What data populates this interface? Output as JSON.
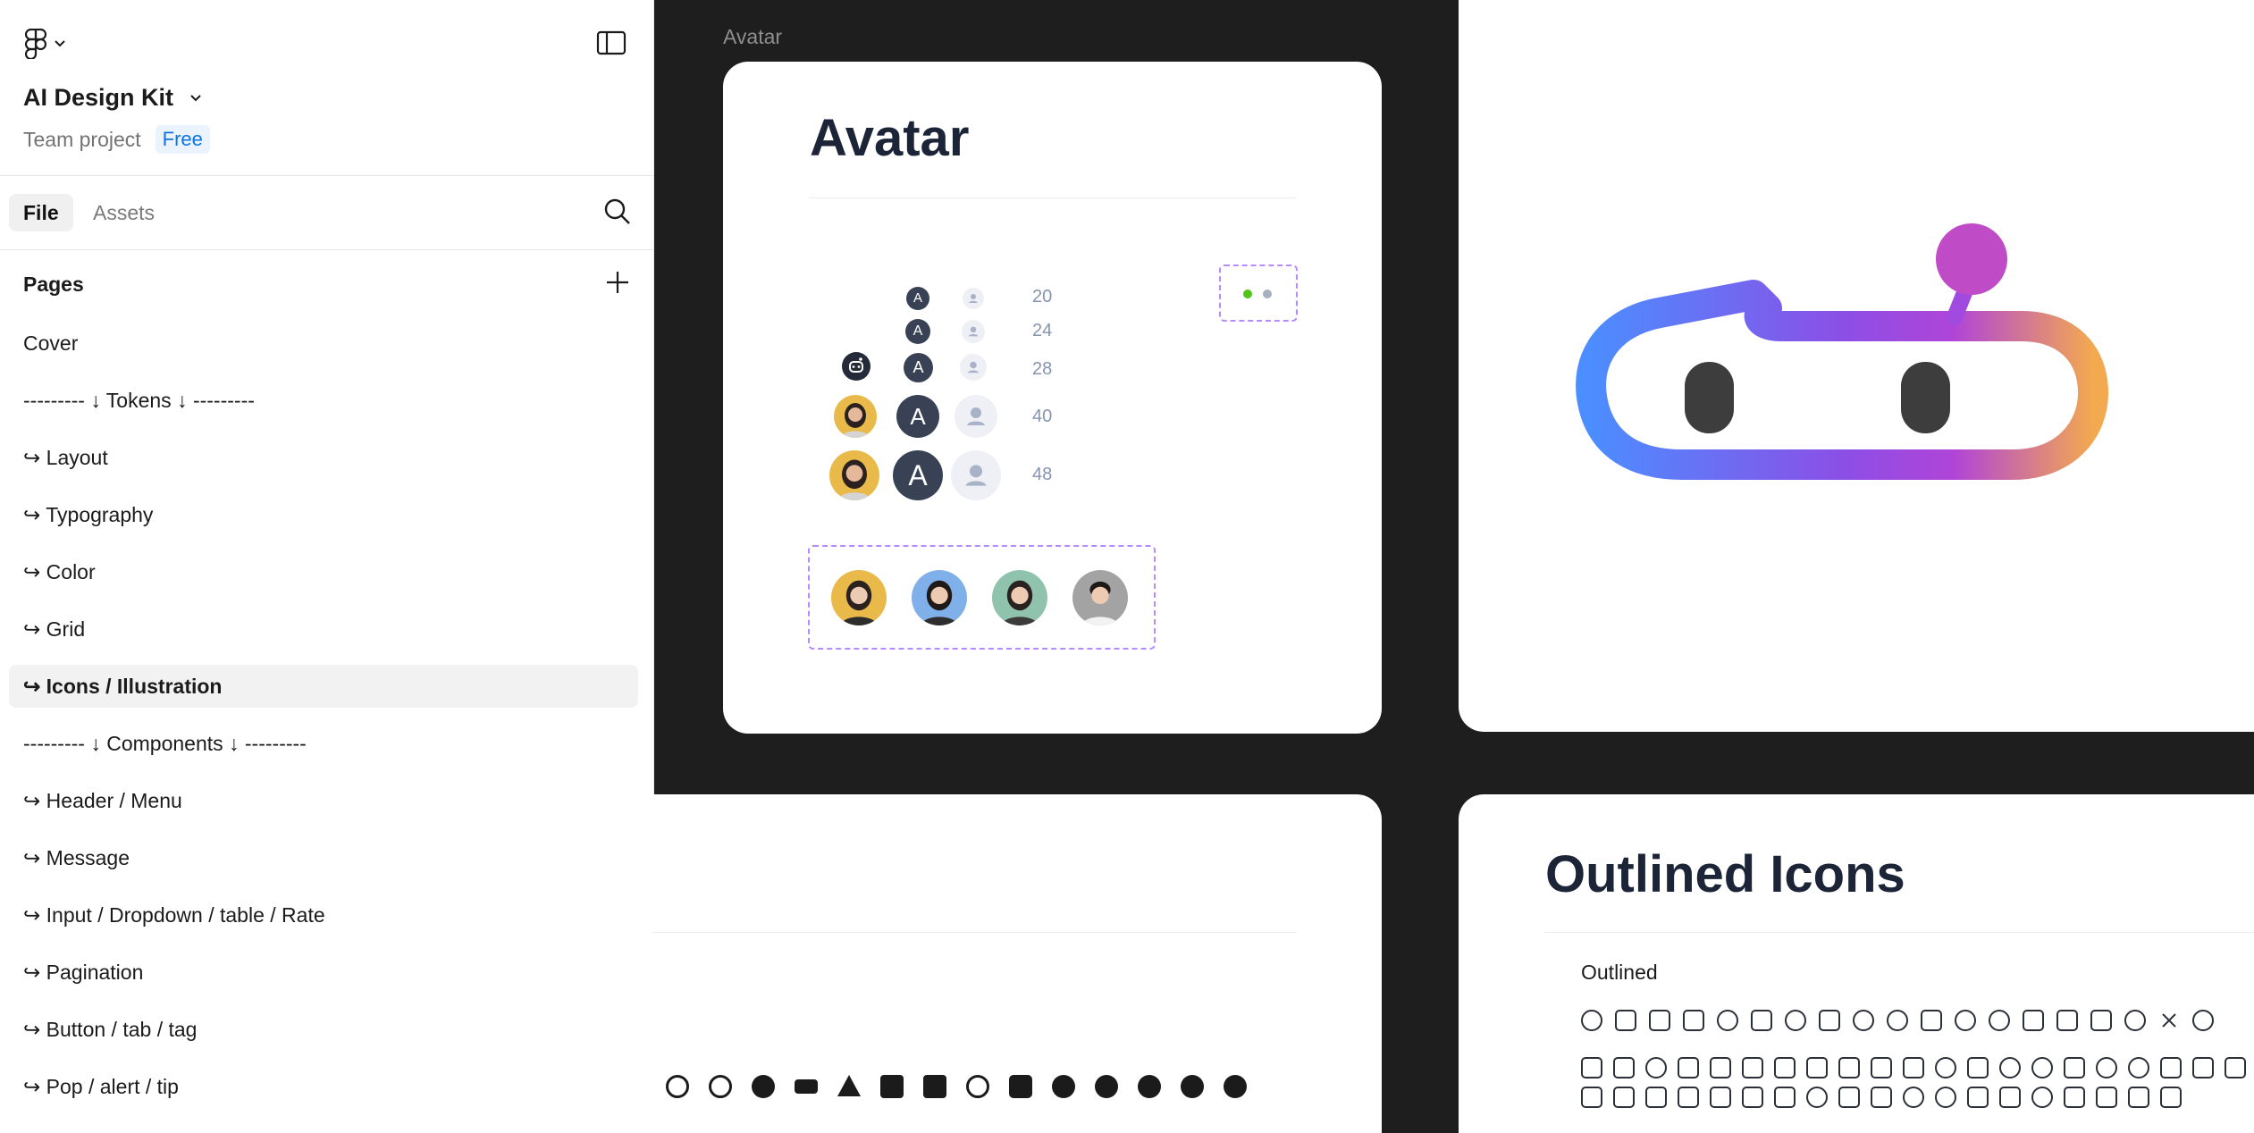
{
  "sidebar": {
    "project_title": "AI Design Kit",
    "team_label": "Team project",
    "plan_badge": "Free",
    "tabs": [
      "File",
      "Assets"
    ],
    "pages_heading": "Pages",
    "pages": [
      "Cover",
      "--------- ↓ Tokens ↓ ---------",
      "↪ Layout",
      "↪ Typography",
      "↪ Color",
      "↪ Grid",
      "↪ Icons / Illustration",
      "--------- ↓ Components ↓ ---------",
      "↪ Header / Menu",
      "↪ Message",
      "↪ Input / Dropdown / table / Rate",
      "↪ Pagination",
      "↪ Button / tab / tag",
      "↪ Pop / alert / tip"
    ],
    "active_page_index": 6
  },
  "canvas": {
    "frame_label": "Avatar",
    "avatar_card": {
      "title": "Avatar",
      "letter": "A",
      "sizes": [
        "20",
        "24",
        "28",
        "40",
        "48"
      ]
    },
    "outlined_card": {
      "title": "Outlined Icons",
      "subtitle": "Outlined"
    }
  },
  "colors": {
    "accent_blue": "#0d74e7",
    "avatar_dark": "#394255",
    "dashed_purple": "#b58bff",
    "logo_gradient": [
      "#4c8dff",
      "#8b4fe6",
      "#b044d8",
      "#f3a94f"
    ]
  }
}
